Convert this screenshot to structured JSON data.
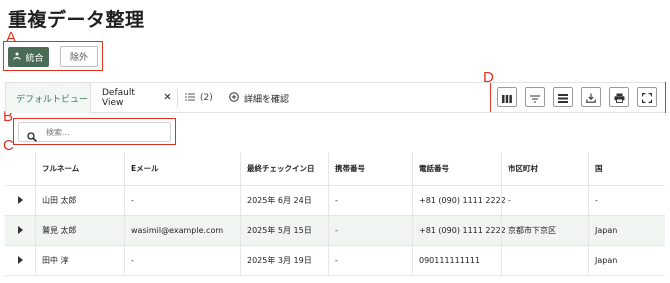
{
  "page": {
    "title": "重複データ整理"
  },
  "annotations": {
    "a": "A",
    "b": "B",
    "c": "C",
    "d": "D"
  },
  "actions": {
    "merge_label": "統合",
    "exclude_label": "除外"
  },
  "tabs": {
    "active_label": "デフォルトビュー",
    "default_view_label": "Default View",
    "list_count": "(2)",
    "details_label": "詳細を確認"
  },
  "toolbar": {
    "icons": [
      "columns-icon",
      "filter-icon",
      "density-icon",
      "download-icon",
      "print-icon",
      "fullscreen-icon"
    ]
  },
  "search": {
    "placeholder": "検索..."
  },
  "table": {
    "columns": [
      "フルネーム",
      "Eメール",
      "最終チェックイン日",
      "携帯番号",
      "電話番号",
      "市区町村",
      "国"
    ],
    "rows": [
      {
        "full_name": "山田 太郎",
        "email": "-",
        "last_checkin": "2025年 6月 24日",
        "mobile": "-",
        "phone": "+81 (090) 1111 2222",
        "city": "-",
        "country": "-"
      },
      {
        "full_name": "鷲見 太郎",
        "email": "wasimil@example.com",
        "last_checkin": "2025年 5月 15日",
        "mobile": "-",
        "phone": "+81 (090) 1111 2222",
        "city": "京都市下京区",
        "country": "Japan"
      },
      {
        "full_name": "田中 淳",
        "email": "-",
        "last_checkin": "2025年 3月 19日",
        "mobile": "-",
        "phone": "090111111111",
        "city": "",
        "country": "Japan"
      }
    ]
  },
  "colors": {
    "accent": "#4a6b56",
    "annotation": "#e0301e",
    "row_highlight": "#f1f5f2"
  }
}
